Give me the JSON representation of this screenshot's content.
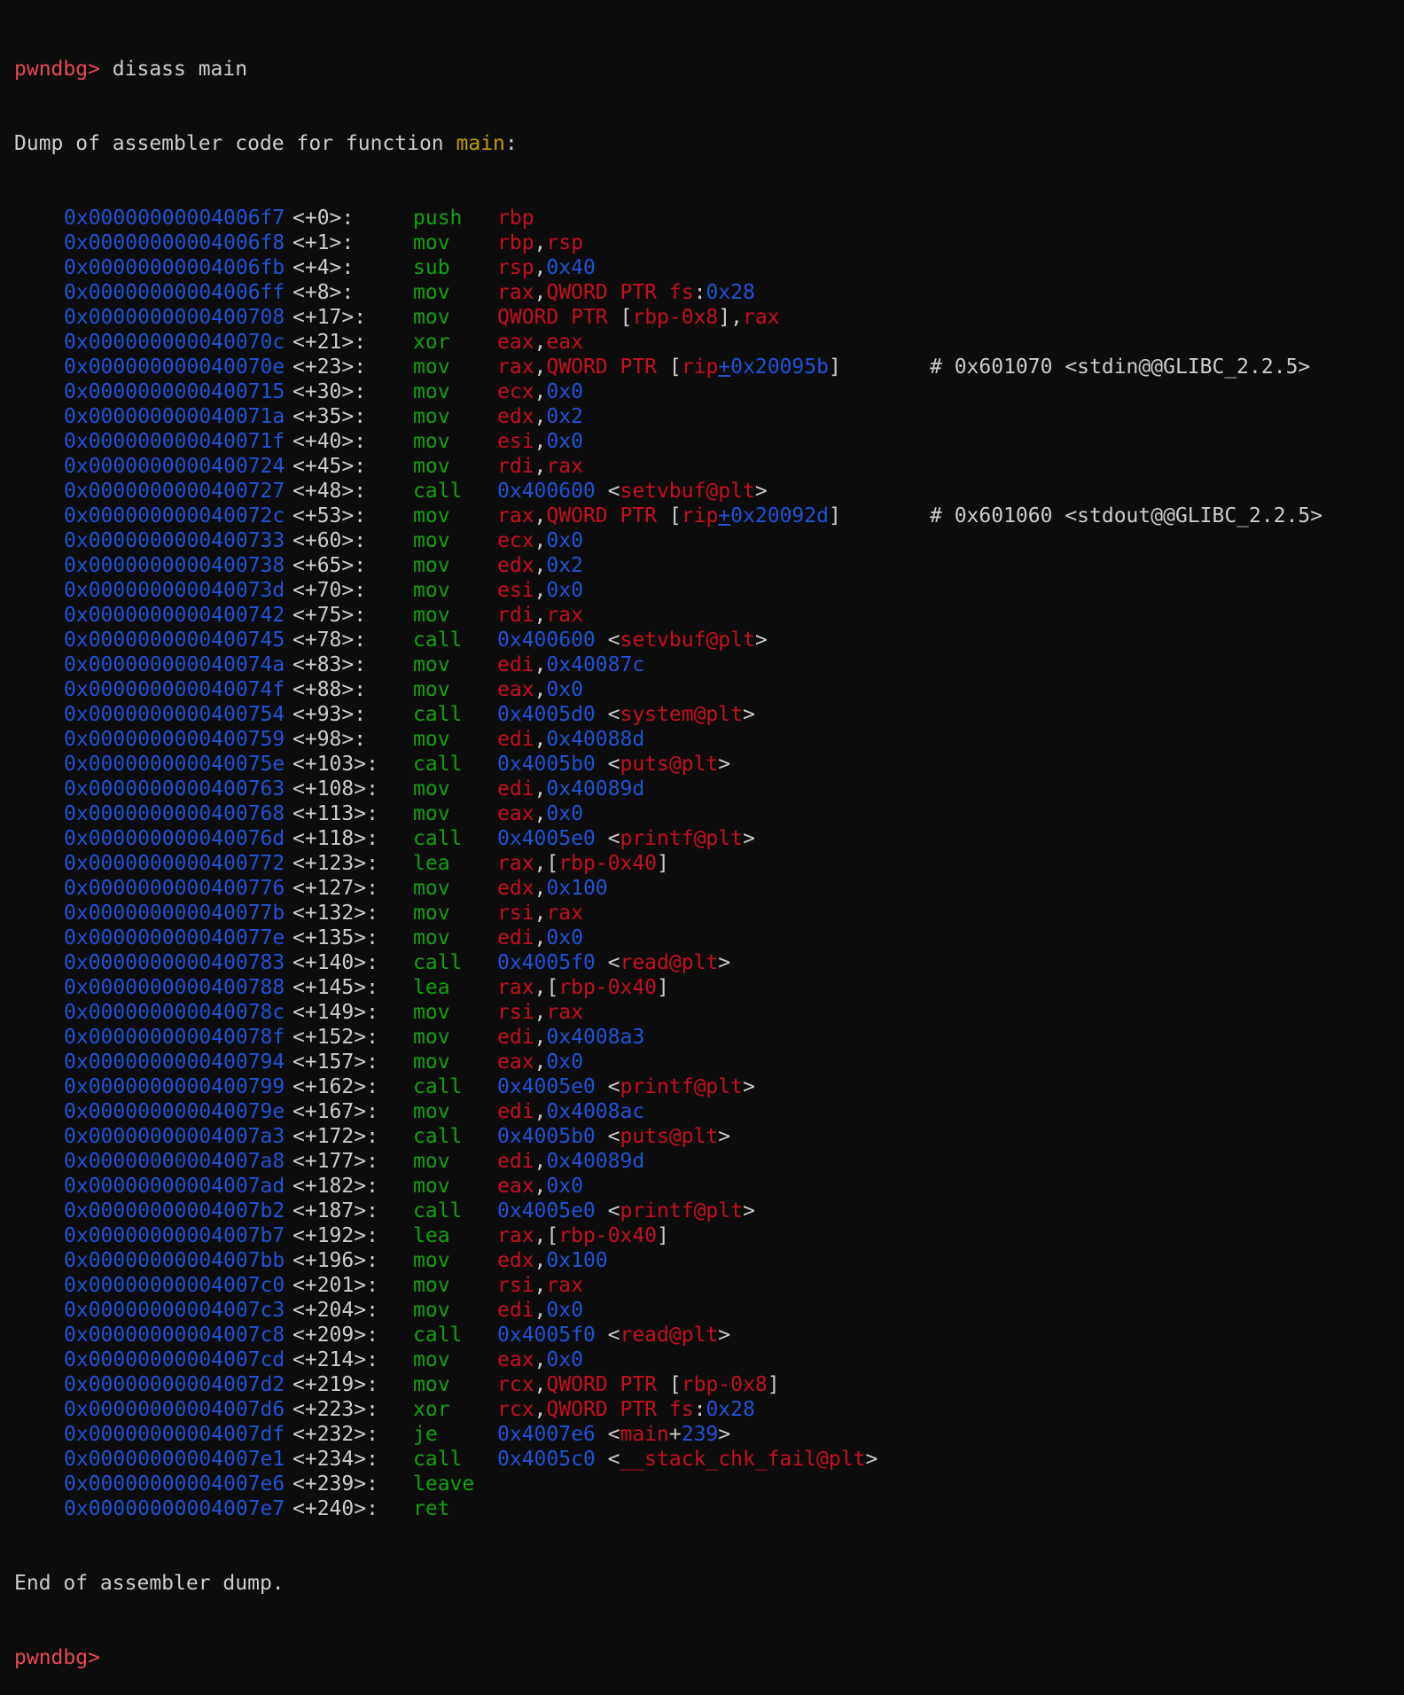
{
  "colors": {
    "background": "#0c0c0c",
    "prompt": "#e74856",
    "function_name": "#c19c00",
    "address": "#1e53d6",
    "mnemonic": "#13a10e",
    "register_symbol": "#c50f1f",
    "text": "#cccccc"
  },
  "prompt": "pwndbg>",
  "command": " disass main",
  "header": {
    "prefix": "Dump of assembler code for function ",
    "function": "main",
    "suffix": ":"
  },
  "instructions": [
    {
      "addr": "0x00000000004006f7",
      "off": "<+0>:",
      "mn": "push",
      "ops": [
        [
          "r",
          "rbp"
        ]
      ]
    },
    {
      "addr": "0x00000000004006f8",
      "off": "<+1>:",
      "mn": "mov",
      "ops": [
        [
          "r",
          "rbp"
        ],
        [
          "p",
          ","
        ],
        [
          "r",
          "rsp"
        ]
      ]
    },
    {
      "addr": "0x00000000004006fb",
      "off": "<+4>:",
      "mn": "sub",
      "ops": [
        [
          "r",
          "rsp"
        ],
        [
          "p",
          ","
        ],
        [
          "n",
          "0x40"
        ]
      ]
    },
    {
      "addr": "0x00000000004006ff",
      "off": "<+8>:",
      "mn": "mov",
      "ops": [
        [
          "r",
          "rax"
        ],
        [
          "p",
          ","
        ],
        [
          "r",
          "QWORD PTR "
        ],
        [
          "r",
          "fs"
        ],
        [
          "p",
          ":"
        ],
        [
          "n",
          "0x28"
        ]
      ]
    },
    {
      "addr": "0x0000000000400708",
      "off": "<+17>:",
      "mn": "mov",
      "ops": [
        [
          "r",
          "QWORD PTR "
        ],
        [
          "p",
          "["
        ],
        [
          "r",
          "rbp-0x8"
        ],
        [
          "p",
          "],"
        ],
        [
          "r",
          "rax"
        ]
      ]
    },
    {
      "addr": "0x000000000040070c",
      "off": "<+21>:",
      "mn": "xor",
      "ops": [
        [
          "r",
          "eax"
        ],
        [
          "p",
          ","
        ],
        [
          "r",
          "eax"
        ]
      ]
    },
    {
      "addr": "0x000000000040070e",
      "off": "<+23>:",
      "mn": "mov",
      "ops": [
        [
          "r",
          "rax"
        ],
        [
          "p",
          ","
        ],
        [
          "r",
          "QWORD PTR "
        ],
        [
          "p",
          "["
        ],
        [
          "r",
          "rip"
        ],
        [
          "u",
          "+"
        ],
        [
          "n",
          "0x20095b"
        ],
        [
          "p",
          "]"
        ]
      ],
      "cmt": "# 0x601070 <stdin@@GLIBC_2.2.5>"
    },
    {
      "addr": "0x0000000000400715",
      "off": "<+30>:",
      "mn": "mov",
      "ops": [
        [
          "r",
          "ecx"
        ],
        [
          "p",
          ","
        ],
        [
          "n",
          "0x0"
        ]
      ]
    },
    {
      "addr": "0x000000000040071a",
      "off": "<+35>:",
      "mn": "mov",
      "ops": [
        [
          "r",
          "edx"
        ],
        [
          "p",
          ","
        ],
        [
          "n",
          "0x2"
        ]
      ]
    },
    {
      "addr": "0x000000000040071f",
      "off": "<+40>:",
      "mn": "mov",
      "ops": [
        [
          "r",
          "esi"
        ],
        [
          "p",
          ","
        ],
        [
          "n",
          "0x0"
        ]
      ]
    },
    {
      "addr": "0x0000000000400724",
      "off": "<+45>:",
      "mn": "mov",
      "ops": [
        [
          "r",
          "rdi"
        ],
        [
          "p",
          ","
        ],
        [
          "r",
          "rax"
        ]
      ]
    },
    {
      "addr": "0x0000000000400727",
      "off": "<+48>:",
      "mn": "call",
      "ops": [
        [
          "n",
          "0x400600"
        ],
        [
          "p",
          " <"
        ],
        [
          "r",
          "setvbuf@plt"
        ],
        [
          "p",
          ">"
        ]
      ]
    },
    {
      "addr": "0x000000000040072c",
      "off": "<+53>:",
      "mn": "mov",
      "ops": [
        [
          "r",
          "rax"
        ],
        [
          "p",
          ","
        ],
        [
          "r",
          "QWORD PTR "
        ],
        [
          "p",
          "["
        ],
        [
          "r",
          "rip"
        ],
        [
          "u",
          "+"
        ],
        [
          "n",
          "0x20092d"
        ],
        [
          "p",
          "]"
        ]
      ],
      "cmt": "# 0x601060 <stdout@@GLIBC_2.2.5>"
    },
    {
      "addr": "0x0000000000400733",
      "off": "<+60>:",
      "mn": "mov",
      "ops": [
        [
          "r",
          "ecx"
        ],
        [
          "p",
          ","
        ],
        [
          "n",
          "0x0"
        ]
      ]
    },
    {
      "addr": "0x0000000000400738",
      "off": "<+65>:",
      "mn": "mov",
      "ops": [
        [
          "r",
          "edx"
        ],
        [
          "p",
          ","
        ],
        [
          "n",
          "0x2"
        ]
      ]
    },
    {
      "addr": "0x000000000040073d",
      "off": "<+70>:",
      "mn": "mov",
      "ops": [
        [
          "r",
          "esi"
        ],
        [
          "p",
          ","
        ],
        [
          "n",
          "0x0"
        ]
      ]
    },
    {
      "addr": "0x0000000000400742",
      "off": "<+75>:",
      "mn": "mov",
      "ops": [
        [
          "r",
          "rdi"
        ],
        [
          "p",
          ","
        ],
        [
          "r",
          "rax"
        ]
      ]
    },
    {
      "addr": "0x0000000000400745",
      "off": "<+78>:",
      "mn": "call",
      "ops": [
        [
          "n",
          "0x400600"
        ],
        [
          "p",
          " <"
        ],
        [
          "r",
          "setvbuf@plt"
        ],
        [
          "p",
          ">"
        ]
      ]
    },
    {
      "addr": "0x000000000040074a",
      "off": "<+83>:",
      "mn": "mov",
      "ops": [
        [
          "r",
          "edi"
        ],
        [
          "p",
          ","
        ],
        [
          "n",
          "0x40087c"
        ]
      ]
    },
    {
      "addr": "0x000000000040074f",
      "off": "<+88>:",
      "mn": "mov",
      "ops": [
        [
          "r",
          "eax"
        ],
        [
          "p",
          ","
        ],
        [
          "n",
          "0x0"
        ]
      ]
    },
    {
      "addr": "0x0000000000400754",
      "off": "<+93>:",
      "mn": "call",
      "ops": [
        [
          "n",
          "0x4005d0"
        ],
        [
          "p",
          " <"
        ],
        [
          "r",
          "system@plt"
        ],
        [
          "p",
          ">"
        ]
      ]
    },
    {
      "addr": "0x0000000000400759",
      "off": "<+98>:",
      "mn": "mov",
      "ops": [
        [
          "r",
          "edi"
        ],
        [
          "p",
          ","
        ],
        [
          "n",
          "0x40088d"
        ]
      ]
    },
    {
      "addr": "0x000000000040075e",
      "off": "<+103>:",
      "mn": "call",
      "ops": [
        [
          "n",
          "0x4005b0"
        ],
        [
          "p",
          " <"
        ],
        [
          "r",
          "puts@plt"
        ],
        [
          "p",
          ">"
        ]
      ]
    },
    {
      "addr": "0x0000000000400763",
      "off": "<+108>:",
      "mn": "mov",
      "ops": [
        [
          "r",
          "edi"
        ],
        [
          "p",
          ","
        ],
        [
          "n",
          "0x40089d"
        ]
      ]
    },
    {
      "addr": "0x0000000000400768",
      "off": "<+113>:",
      "mn": "mov",
      "ops": [
        [
          "r",
          "eax"
        ],
        [
          "p",
          ","
        ],
        [
          "n",
          "0x0"
        ]
      ]
    },
    {
      "addr": "0x000000000040076d",
      "off": "<+118>:",
      "mn": "call",
      "ops": [
        [
          "n",
          "0x4005e0"
        ],
        [
          "p",
          " <"
        ],
        [
          "r",
          "printf@plt"
        ],
        [
          "p",
          ">"
        ]
      ]
    },
    {
      "addr": "0x0000000000400772",
      "off": "<+123>:",
      "mn": "lea",
      "ops": [
        [
          "r",
          "rax"
        ],
        [
          "p",
          ",["
        ],
        [
          "r",
          "rbp-0x40"
        ],
        [
          "p",
          "]"
        ]
      ]
    },
    {
      "addr": "0x0000000000400776",
      "off": "<+127>:",
      "mn": "mov",
      "ops": [
        [
          "r",
          "edx"
        ],
        [
          "p",
          ","
        ],
        [
          "n",
          "0x100"
        ]
      ]
    },
    {
      "addr": "0x000000000040077b",
      "off": "<+132>:",
      "mn": "mov",
      "ops": [
        [
          "r",
          "rsi"
        ],
        [
          "p",
          ","
        ],
        [
          "r",
          "rax"
        ]
      ]
    },
    {
      "addr": "0x000000000040077e",
      "off": "<+135>:",
      "mn": "mov",
      "ops": [
        [
          "r",
          "edi"
        ],
        [
          "p",
          ","
        ],
        [
          "n",
          "0x0"
        ]
      ]
    },
    {
      "addr": "0x0000000000400783",
      "off": "<+140>:",
      "mn": "call",
      "ops": [
        [
          "n",
          "0x4005f0"
        ],
        [
          "p",
          " <"
        ],
        [
          "r",
          "read@plt"
        ],
        [
          "p",
          ">"
        ]
      ]
    },
    {
      "addr": "0x0000000000400788",
      "off": "<+145>:",
      "mn": "lea",
      "ops": [
        [
          "r",
          "rax"
        ],
        [
          "p",
          ",["
        ],
        [
          "r",
          "rbp-0x40"
        ],
        [
          "p",
          "]"
        ]
      ]
    },
    {
      "addr": "0x000000000040078c",
      "off": "<+149>:",
      "mn": "mov",
      "ops": [
        [
          "r",
          "rsi"
        ],
        [
          "p",
          ","
        ],
        [
          "r",
          "rax"
        ]
      ]
    },
    {
      "addr": "0x000000000040078f",
      "off": "<+152>:",
      "mn": "mov",
      "ops": [
        [
          "r",
          "edi"
        ],
        [
          "p",
          ","
        ],
        [
          "n",
          "0x4008a3"
        ]
      ]
    },
    {
      "addr": "0x0000000000400794",
      "off": "<+157>:",
      "mn": "mov",
      "ops": [
        [
          "r",
          "eax"
        ],
        [
          "p",
          ","
        ],
        [
          "n",
          "0x0"
        ]
      ]
    },
    {
      "addr": "0x0000000000400799",
      "off": "<+162>:",
      "mn": "call",
      "ops": [
        [
          "n",
          "0x4005e0"
        ],
        [
          "p",
          " <"
        ],
        [
          "r",
          "printf@plt"
        ],
        [
          "p",
          ">"
        ]
      ]
    },
    {
      "addr": "0x000000000040079e",
      "off": "<+167>:",
      "mn": "mov",
      "ops": [
        [
          "r",
          "edi"
        ],
        [
          "p",
          ","
        ],
        [
          "n",
          "0x4008ac"
        ]
      ]
    },
    {
      "addr": "0x00000000004007a3",
      "off": "<+172>:",
      "mn": "call",
      "ops": [
        [
          "n",
          "0x4005b0"
        ],
        [
          "p",
          " <"
        ],
        [
          "r",
          "puts@plt"
        ],
        [
          "p",
          ">"
        ]
      ]
    },
    {
      "addr": "0x00000000004007a8",
      "off": "<+177>:",
      "mn": "mov",
      "ops": [
        [
          "r",
          "edi"
        ],
        [
          "p",
          ","
        ],
        [
          "n",
          "0x40089d"
        ]
      ]
    },
    {
      "addr": "0x00000000004007ad",
      "off": "<+182>:",
      "mn": "mov",
      "ops": [
        [
          "r",
          "eax"
        ],
        [
          "p",
          ","
        ],
        [
          "n",
          "0x0"
        ]
      ]
    },
    {
      "addr": "0x00000000004007b2",
      "off": "<+187>:",
      "mn": "call",
      "ops": [
        [
          "n",
          "0x4005e0"
        ],
        [
          "p",
          " <"
        ],
        [
          "r",
          "printf@plt"
        ],
        [
          "p",
          ">"
        ]
      ]
    },
    {
      "addr": "0x00000000004007b7",
      "off": "<+192>:",
      "mn": "lea",
      "ops": [
        [
          "r",
          "rax"
        ],
        [
          "p",
          ",["
        ],
        [
          "r",
          "rbp-0x40"
        ],
        [
          "p",
          "]"
        ]
      ]
    },
    {
      "addr": "0x00000000004007bb",
      "off": "<+196>:",
      "mn": "mov",
      "ops": [
        [
          "r",
          "edx"
        ],
        [
          "p",
          ","
        ],
        [
          "n",
          "0x100"
        ]
      ]
    },
    {
      "addr": "0x00000000004007c0",
      "off": "<+201>:",
      "mn": "mov",
      "ops": [
        [
          "r",
          "rsi"
        ],
        [
          "p",
          ","
        ],
        [
          "r",
          "rax"
        ]
      ]
    },
    {
      "addr": "0x00000000004007c3",
      "off": "<+204>:",
      "mn": "mov",
      "ops": [
        [
          "r",
          "edi"
        ],
        [
          "p",
          ","
        ],
        [
          "n",
          "0x0"
        ]
      ]
    },
    {
      "addr": "0x00000000004007c8",
      "off": "<+209>:",
      "mn": "call",
      "ops": [
        [
          "n",
          "0x4005f0"
        ],
        [
          "p",
          " <"
        ],
        [
          "r",
          "read@plt"
        ],
        [
          "p",
          ">"
        ]
      ]
    },
    {
      "addr": "0x00000000004007cd",
      "off": "<+214>:",
      "mn": "mov",
      "ops": [
        [
          "r",
          "eax"
        ],
        [
          "p",
          ","
        ],
        [
          "n",
          "0x0"
        ]
      ]
    },
    {
      "addr": "0x00000000004007d2",
      "off": "<+219>:",
      "mn": "mov",
      "ops": [
        [
          "r",
          "rcx"
        ],
        [
          "p",
          ","
        ],
        [
          "r",
          "QWORD PTR "
        ],
        [
          "p",
          "["
        ],
        [
          "r",
          "rbp-0x8"
        ],
        [
          "p",
          "]"
        ]
      ]
    },
    {
      "addr": "0x00000000004007d6",
      "off": "<+223>:",
      "mn": "xor",
      "ops": [
        [
          "r",
          "rcx"
        ],
        [
          "p",
          ","
        ],
        [
          "r",
          "QWORD PTR "
        ],
        [
          "r",
          "fs"
        ],
        [
          "p",
          ":"
        ],
        [
          "n",
          "0x28"
        ]
      ]
    },
    {
      "addr": "0x00000000004007df",
      "off": "<+232>:",
      "mn": "je",
      "ops": [
        [
          "n",
          "0x4007e6"
        ],
        [
          "p",
          " <"
        ],
        [
          "r",
          "main"
        ],
        [
          "p",
          "+"
        ],
        [
          "n",
          "239"
        ],
        [
          "p",
          ">"
        ]
      ]
    },
    {
      "addr": "0x00000000004007e1",
      "off": "<+234>:",
      "mn": "call",
      "ops": [
        [
          "n",
          "0x4005c0"
        ],
        [
          "p",
          " <"
        ],
        [
          "r",
          "__stack_chk_fail@plt"
        ],
        [
          "p",
          ">"
        ]
      ]
    },
    {
      "addr": "0x00000000004007e6",
      "off": "<+239>:",
      "mn": "leave",
      "ops": []
    },
    {
      "addr": "0x00000000004007e7",
      "off": "<+240>:",
      "mn": "ret",
      "ops": []
    }
  ],
  "footer": "End of assembler dump.",
  "final_prompt": "pwndbg>"
}
